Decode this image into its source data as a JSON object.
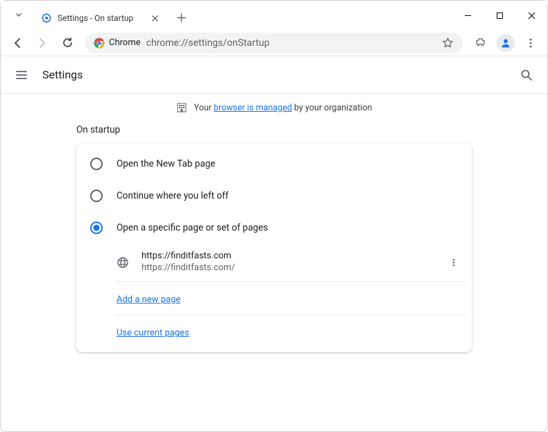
{
  "window": {
    "tab_title": "Settings - On startup"
  },
  "toolbar": {
    "chrome_label": "Chrome",
    "url": "chrome://settings/onStartup"
  },
  "header": {
    "title": "Settings"
  },
  "managed": {
    "prefix": "Your ",
    "link": "browser is managed",
    "suffix": " by your organization"
  },
  "section": {
    "label": "On startup"
  },
  "options": {
    "new_tab": "Open the New Tab page",
    "continue": "Continue where you left off",
    "specific": "Open a specific page or set of pages"
  },
  "page": {
    "title": "https://finditfasts.com",
    "url": "https://finditfasts.com/"
  },
  "links": {
    "add": "Add a new page",
    "current": "Use current pages"
  }
}
